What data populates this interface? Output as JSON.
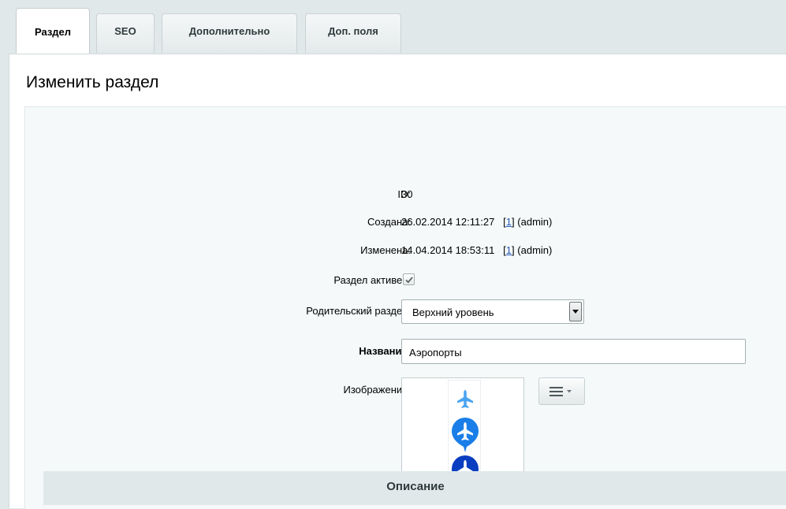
{
  "tabs": [
    {
      "label": "Раздел",
      "active": true
    },
    {
      "label": "SEO",
      "active": false
    },
    {
      "label": "Дополнительно",
      "active": false
    },
    {
      "label": "Доп. поля",
      "active": false
    }
  ],
  "page_title": "Изменить раздел",
  "form": {
    "id": {
      "label": "ID:",
      "value": "30"
    },
    "created": {
      "label": "Создана:",
      "date": "26.02.2014 12:11:27",
      "bracket_open": "[",
      "user_link": "1",
      "bracket_close": "]",
      "user_name": "(admin)"
    },
    "modified": {
      "label": "Изменена:",
      "date": "14.04.2014 18:53:11",
      "bracket_open": "[",
      "user_link": "1",
      "bracket_close": "]",
      "user_name": "(admin)"
    },
    "active": {
      "label": "Раздел активен:",
      "checked": true
    },
    "parent": {
      "label": "Родительский раздел:",
      "value": "Верхний уровень"
    },
    "name": {
      "label": "Название:",
      "value": "Аэропорты"
    },
    "image": {
      "label": "Изображение:"
    }
  },
  "section_header": "Описание",
  "colors": {
    "page_bg": "#e0e8ea",
    "link": "#2a5cb8",
    "plane_light": "#4aa3f0",
    "pin_mid": "#1a7ee8",
    "pin_dark": "#0a3ec0"
  },
  "icons": [
    "checkmark-icon",
    "dropdown-arrow-icon",
    "airplane-icon",
    "map-pin-icon",
    "hamburger-menu-icon",
    "caret-down-icon"
  ]
}
